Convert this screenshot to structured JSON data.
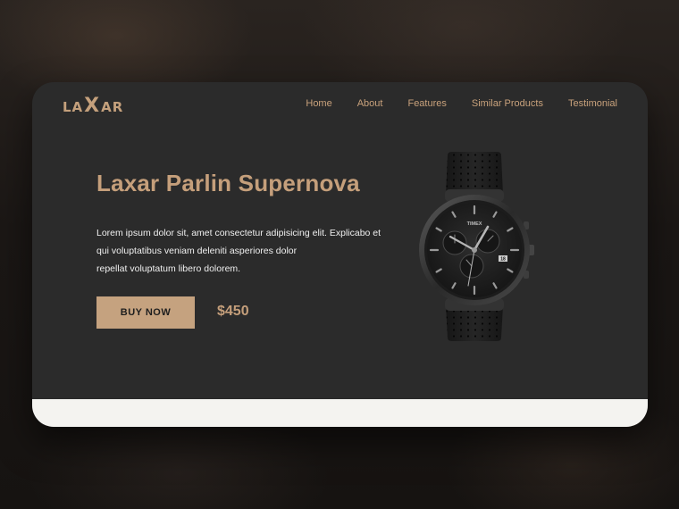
{
  "brand": {
    "logo_prefix": "LA",
    "logo_mid": "X",
    "logo_suffix": "AR"
  },
  "nav": {
    "items": [
      {
        "label": "Home"
      },
      {
        "label": "About"
      },
      {
        "label": "Features"
      },
      {
        "label": "Similar Products"
      },
      {
        "label": "Testimonial"
      }
    ]
  },
  "hero": {
    "title": "Laxar Parlin Supernova",
    "description_lines": [
      "Lorem ipsum dolor sit, amet consectetur adipisicing elit. Explicabo et",
      "qui voluptatibus veniam deleniti asperiores dolor",
      "repellat voluptatum libero dolorem."
    ],
    "buy_label": "BUY NOW",
    "price": "$450",
    "watch_brand": "TIMEX",
    "date_window": "18"
  },
  "colors": {
    "accent": "#c5a27f",
    "card_bg": "#2b2b2b",
    "footer_strip": "#f4f3f0"
  },
  "icons": {
    "product": "wristwatch-image"
  }
}
